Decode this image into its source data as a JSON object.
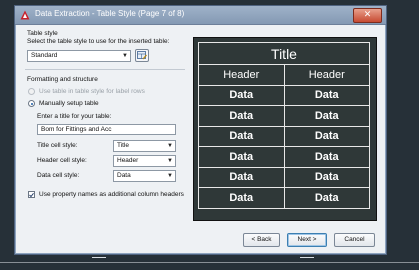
{
  "window": {
    "title": "Data Extraction - Table Style (Page 7 of 8)",
    "close_glyph": "✕"
  },
  "table_style": {
    "heading": "Table style",
    "description": "Select the table style to use for the inserted table:",
    "selected": "Standard"
  },
  "formatting": {
    "heading": "Formatting and structure",
    "option_label_rows": "Use table in table style for label rows",
    "option_manual": "Manually setup table",
    "title_prompt": "Enter a title for your table:",
    "title_value": "Bom for Fittings and Acc",
    "title_cell_label": "Title cell style:",
    "title_cell_value": "Title",
    "header_cell_label": "Header cell style:",
    "header_cell_value": "Header",
    "data_cell_label": "Data cell style:",
    "data_cell_value": "Data",
    "property_names_label": "Use property names as additional column headers",
    "property_names_checked": true
  },
  "preview": {
    "title": "Title",
    "headers": [
      "Header",
      "Header"
    ],
    "rows": [
      [
        "Data",
        "Data"
      ],
      [
        "Data",
        "Data"
      ],
      [
        "Data",
        "Data"
      ],
      [
        "Data",
        "Data"
      ],
      [
        "Data",
        "Data"
      ],
      [
        "Data",
        "Data"
      ]
    ]
  },
  "buttons": {
    "back": "< Back",
    "next": "Next >",
    "cancel": "Cancel"
  },
  "colors": {
    "titlebar": "#8ea3bd",
    "close": "#c74a31",
    "preview_bg": "#2f3838",
    "cad_background": "#263038"
  }
}
